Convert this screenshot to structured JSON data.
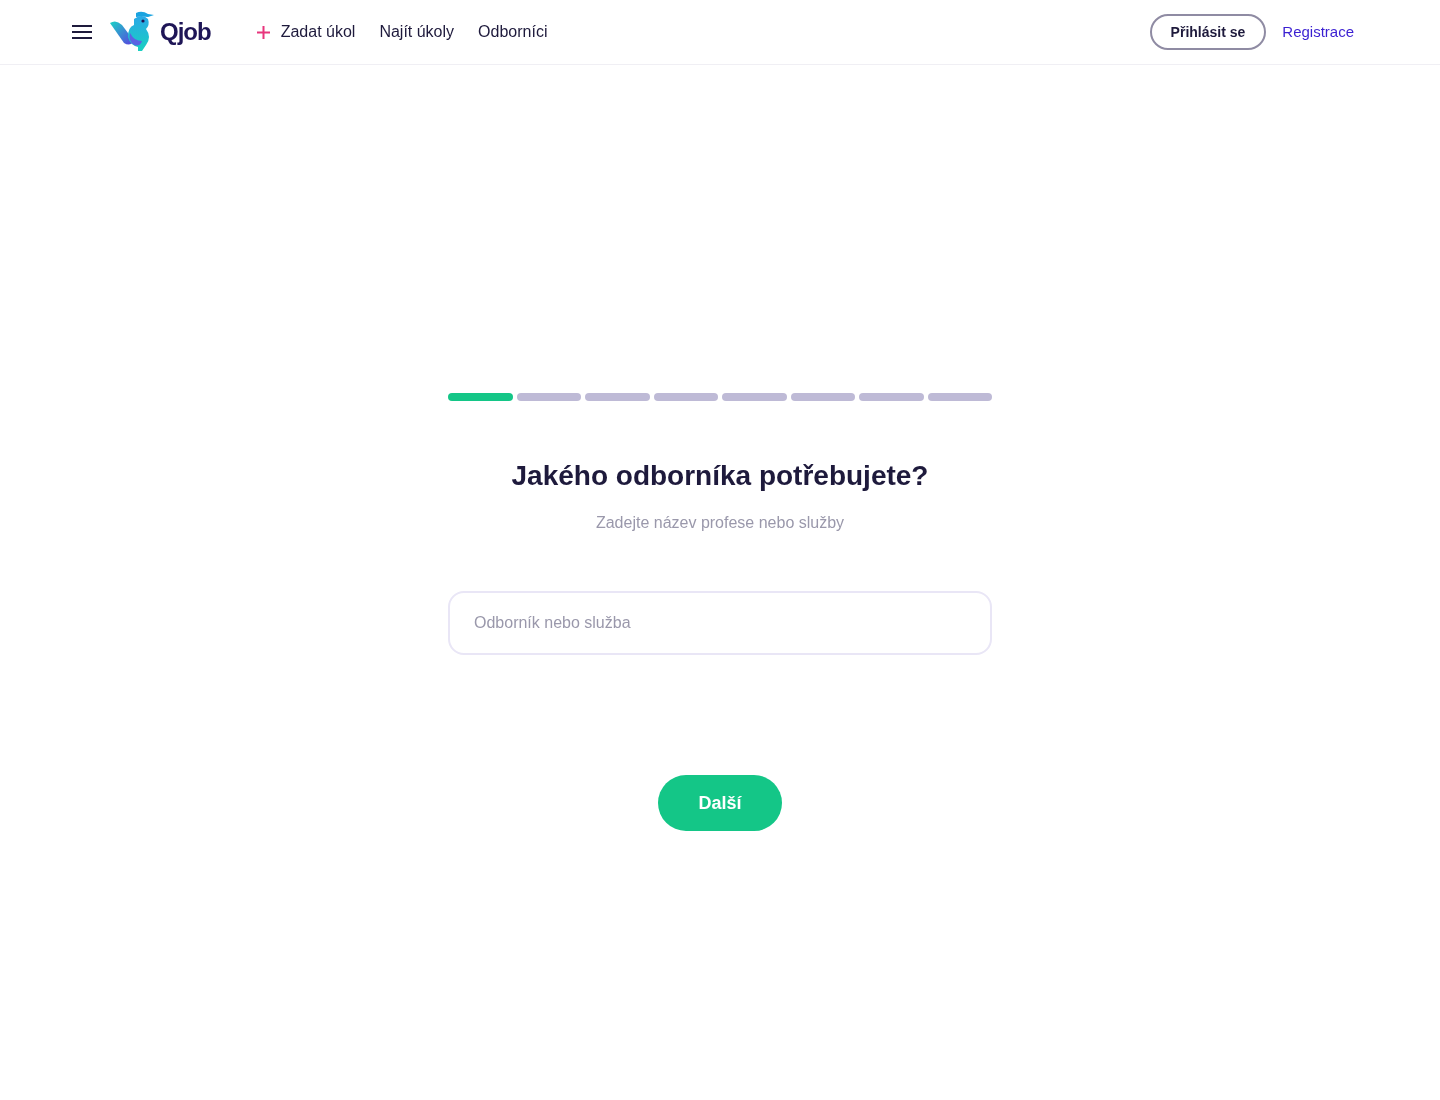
{
  "header": {
    "logo_text": "Qjob",
    "nav": [
      {
        "label": "Zadat úkol",
        "kind": "add"
      },
      {
        "label": "Najít úkoly",
        "kind": "link"
      },
      {
        "label": "Odborníci",
        "kind": "link"
      }
    ],
    "login_button": "Přihlásit se",
    "register_link": "Registrace"
  },
  "progress": {
    "steps": [
      {
        "completed": true
      },
      {
        "completed": false
      },
      {
        "completed": false
      },
      {
        "completed": false
      },
      {
        "completed": false
      },
      {
        "completed": false
      },
      {
        "completed": false
      },
      {
        "completed": false
      }
    ]
  },
  "question": {
    "title": "Jakého odborníka potřebujete?",
    "subtitle": "Zadejte název profese nebo služby"
  },
  "search": {
    "placeholder": "Odborník nebo služba"
  },
  "next_button": "Další"
}
